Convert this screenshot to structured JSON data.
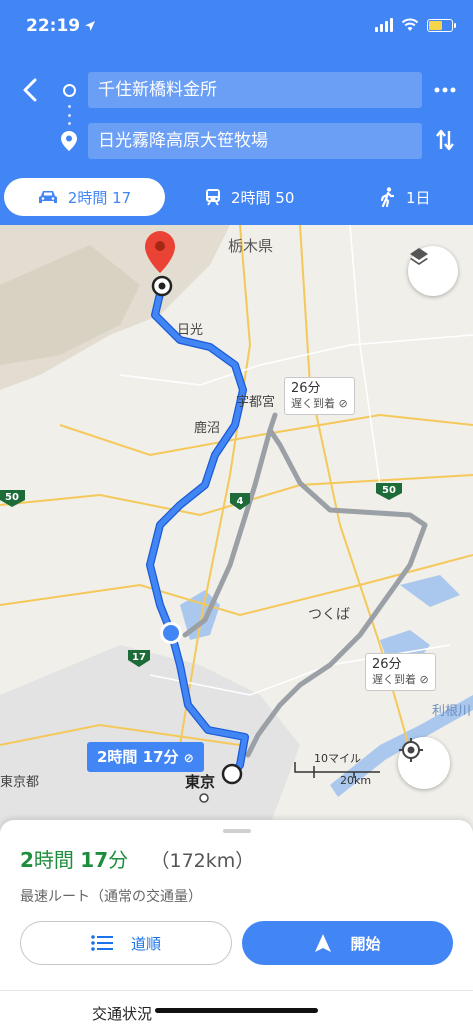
{
  "status_bar": {
    "time": "22:19"
  },
  "directions": {
    "from": "千住新橋料金所",
    "to": "日光霧降高原大笹牧場",
    "modes": [
      {
        "name": "car",
        "label": "2時間 17",
        "selected": true
      },
      {
        "name": "transit",
        "label": "2時間 50",
        "selected": false
      },
      {
        "name": "walk",
        "label": "1日",
        "selected": false
      }
    ]
  },
  "map": {
    "labels": {
      "tochigi": "栃木県",
      "nikko": "日光",
      "utsunomiya": "宇都宮",
      "kanuma": "鹿沼",
      "tsukuba": "つくば",
      "tokyo": "東京",
      "tokyo_to": "東京都",
      "tone": "利根川"
    },
    "road_shields": {
      "r50_left": "50",
      "r50_right": "50",
      "r4": "4",
      "r17": "17"
    },
    "callouts": {
      "alt1_time": "26分",
      "alt1_note": "遅く到着",
      "alt2_time": "26分",
      "alt2_note": "遅く到着",
      "main_time": "2時間 17分"
    },
    "scale": {
      "miles": "10マイル",
      "km": "20km"
    },
    "colors": {
      "route": "#4285f4",
      "alt_route": "#9aa0a6",
      "water": "#aac8ee"
    }
  },
  "sheet": {
    "eta_hours": "2",
    "eta_hours_unit": "時間",
    "eta_minutes": "17",
    "eta_minutes_unit": "分",
    "distance": "（172km）",
    "route_desc": "最速ルート（通常の交通量）",
    "steps_label": "道順",
    "start_label": "開始",
    "traffic_label": "交通状況"
  }
}
